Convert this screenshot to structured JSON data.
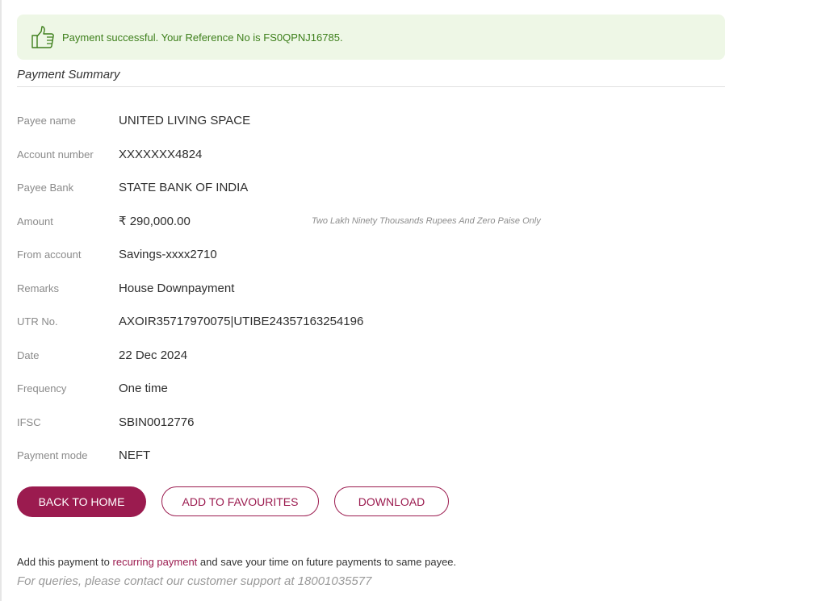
{
  "banner": {
    "message": "Payment successful. Your Reference No is FS0QPNJ16785.",
    "icon": "thumbs-up-icon",
    "color": "#3d7f1b",
    "background": "#eef7e6"
  },
  "summary": {
    "title": "Payment Summary",
    "rows": [
      {
        "label": "Payee name",
        "value": "UNITED LIVING SPACE"
      },
      {
        "label": "Account number",
        "value": "XXXXXXX4824"
      },
      {
        "label": "Payee Bank",
        "value": "STATE BANK OF INDIA"
      },
      {
        "label": "Amount",
        "value": "₹ 290,000.00",
        "words": "Two Lakh Ninety Thousands Rupees And Zero Paise Only"
      },
      {
        "label": "From account",
        "value": "Savings-xxxx2710"
      },
      {
        "label": "Remarks",
        "value": "House Downpayment"
      },
      {
        "label": "UTR No.",
        "value": "AXOIR35717970075|UTIBE24357163254196"
      },
      {
        "label": "Date",
        "value": "22 Dec 2024"
      },
      {
        "label": "Frequency",
        "value": "One time"
      },
      {
        "label": "IFSC",
        "value": "SBIN0012776"
      },
      {
        "label": "Payment mode",
        "value": "NEFT"
      }
    ]
  },
  "actions": {
    "back_home": "BACK TO HOME",
    "add_favourites": "ADD TO FAVOURITES",
    "download": "DOWNLOAD",
    "accent": "#9b1b4f"
  },
  "footer": {
    "recurring_prefix": "Add this payment to ",
    "recurring_link": "recurring payment",
    "recurring_suffix": " and save your time on future payments to same payee.",
    "support": "For queries, please contact our customer support at 18001035577"
  }
}
